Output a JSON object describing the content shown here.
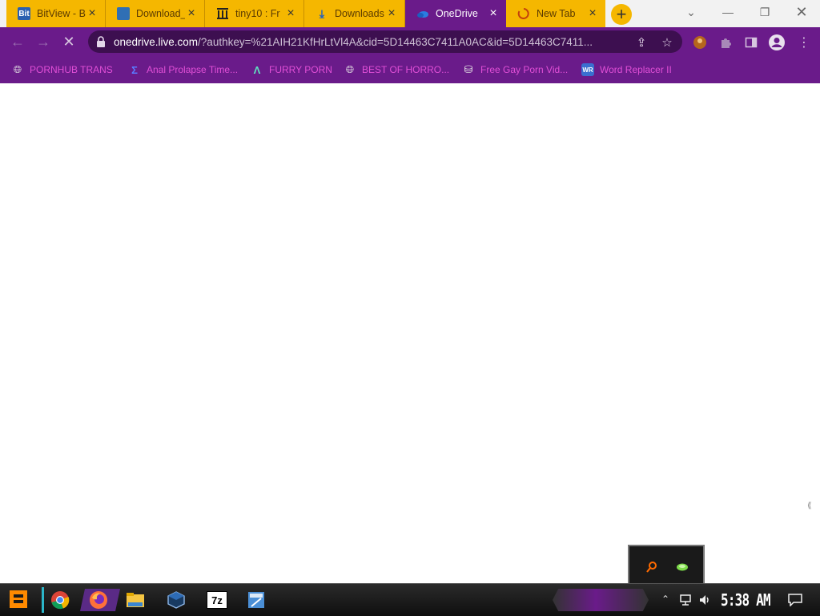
{
  "tabs": [
    {
      "label": "BitView - B",
      "icon": "bitview-icon"
    },
    {
      "label": "Download_",
      "icon": "download-page-icon"
    },
    {
      "label": "tiny10 : Fr",
      "icon": "archive-org-icon"
    },
    {
      "label": "Downloads",
      "icon": "download-arrow-icon"
    },
    {
      "label": "OneDrive",
      "icon": "onedrive-icon"
    },
    {
      "label": "New Tab",
      "icon": "loading-spinner-icon"
    }
  ],
  "omnibox": {
    "domain": "onedrive.live.com",
    "path": "/?authkey=%21AIH21KfHrLtVl4A&cid=5D14463C7411A0AC&id=5D14463C7411..."
  },
  "bookmarks": [
    {
      "label": "PORNHUB TRANS",
      "icon": "globe-icon"
    },
    {
      "label": "Anal Prolapse Time...",
      "icon": "bracket-icon"
    },
    {
      "label": "FURRY PORN",
      "icon": "lambda-icon"
    },
    {
      "label": "BEST OF HORRO...",
      "icon": "globe-icon"
    },
    {
      "label": "Free Gay Porn Vid...",
      "icon": "puzzle-stack-icon"
    },
    {
      "label": "Word Replacer II",
      "icon": "wr-icon"
    }
  ],
  "taskbar": {
    "clock": "5:38 AM",
    "apps": [
      "start-icon",
      "chrome-icon",
      "firefox-icon",
      "file-explorer-icon",
      "virtualbox-icon",
      "7zip-icon",
      "calculator-icon"
    ]
  },
  "colors": {
    "accent": "#6a1b8a",
    "tab_inactive": "#f5b700",
    "bookmark_text": "#e04fd6"
  }
}
